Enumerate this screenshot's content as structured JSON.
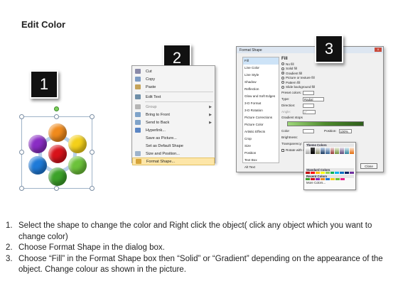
{
  "title": "Edit Color",
  "steps": {
    "badge1": "1",
    "badge2": "2",
    "badge3": "3"
  },
  "context_menu": {
    "items": [
      "Cut",
      "Copy",
      "Paste",
      "Edit Text",
      "Group",
      "Bring to Front",
      "Send to Back",
      "Hyperlink...",
      "Save as Picture...",
      "Set as Default Shape",
      "Size and Position...",
      "Format Shape..."
    ]
  },
  "dialog": {
    "title": "Format Shape",
    "close_glyph": "x",
    "nav": [
      "Fill",
      "Line Color",
      "Line Style",
      "Shadow",
      "Reflection",
      "Glow and Soft Edges",
      "3-D Format",
      "3-D Rotation",
      "Picture Corrections",
      "Picture Color",
      "Artistic Effects",
      "Crop",
      "Size",
      "Position",
      "Text Box",
      "Alt Text"
    ],
    "fill_heading": "Fill",
    "fill_options": [
      "No fill",
      "Solid fill",
      "Gradient fill",
      "Picture or texture fill",
      "Pattern fill",
      "Slide background fill"
    ],
    "preset_label": "Preset colors:",
    "type_label": "Type:",
    "type_value": "Radial",
    "direction_label": "Direction:",
    "angle_label": "Angle:",
    "angle_value": "0°",
    "gradient_stops_label": "Gradient stops",
    "color_label": "Color",
    "position_label": "Position:",
    "position_value": "100%",
    "brightness_label": "Brightness:",
    "transparency_label": "Transparency:",
    "rotate_label": "Rotate with shape",
    "close_label": "Close",
    "palette": {
      "theme_label": "Theme Colors",
      "standard_label": "Standard Colors",
      "recent_label": "Recent Colors",
      "more_label": "More Colors..."
    }
  },
  "instructions": [
    {
      "num": "1.",
      "text": "Select the shape to change the color and Right click the object( click any object which you want to change color)"
    },
    {
      "num": "2.",
      "text": "Choose Format Shape in the dialog box."
    },
    {
      "num": "3.",
      "text": "Choose “Fill” in the Format Shape box then “Solid” or “Gradient” depending on the appearance of the object. Change colour as shown in the picture."
    }
  ],
  "colors": {
    "ball_purple": "#8a2cc4",
    "ball_orange": "#f08a1c",
    "ball_yellow": "#f4d01a",
    "ball_pink": "#e8208a",
    "ball_red": "#d8121a",
    "ball_blue": "#1e7ad8",
    "ball_green": "#3ca22a",
    "ball_lightgreen": "#6cc23a",
    "menu_highlight": "#fde6a8",
    "nav_selected": "#cde3f7"
  }
}
